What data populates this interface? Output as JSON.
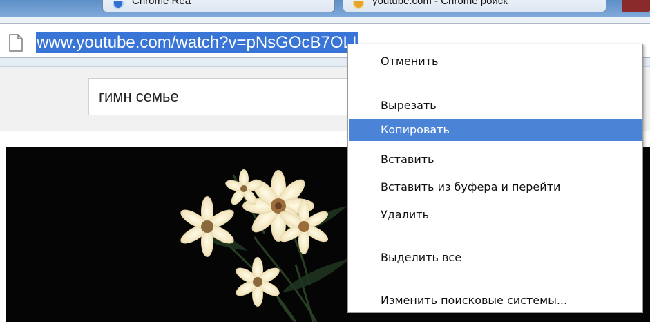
{
  "tabs": [
    {
      "title": "Chrome Rea",
      "icon": "chrome-icon"
    },
    {
      "title": "youtube.com - Chrome poиск",
      "icon": "search-engine-icon"
    }
  ],
  "omnibox": {
    "url": "www.youtube.com/watch?v=pNsGOcB7OLI",
    "page_icon": "page-icon"
  },
  "search": {
    "value": "гимн семье"
  },
  "context_menu": {
    "items": [
      {
        "label": "Отменить"
      },
      {
        "label": "Вырезать"
      },
      {
        "label": "Копировать",
        "highlighted": true
      },
      {
        "label": "Вставить"
      },
      {
        "label": "Вставить из буфера и перейти"
      },
      {
        "label": "Удалить"
      },
      {
        "label": "Выделить все"
      },
      {
        "label": "Изменить поисковые системы..."
      }
    ]
  },
  "colors": {
    "selection": "#3875d7",
    "menu_highlight": "#4b84d6",
    "video_background": "#050505"
  }
}
